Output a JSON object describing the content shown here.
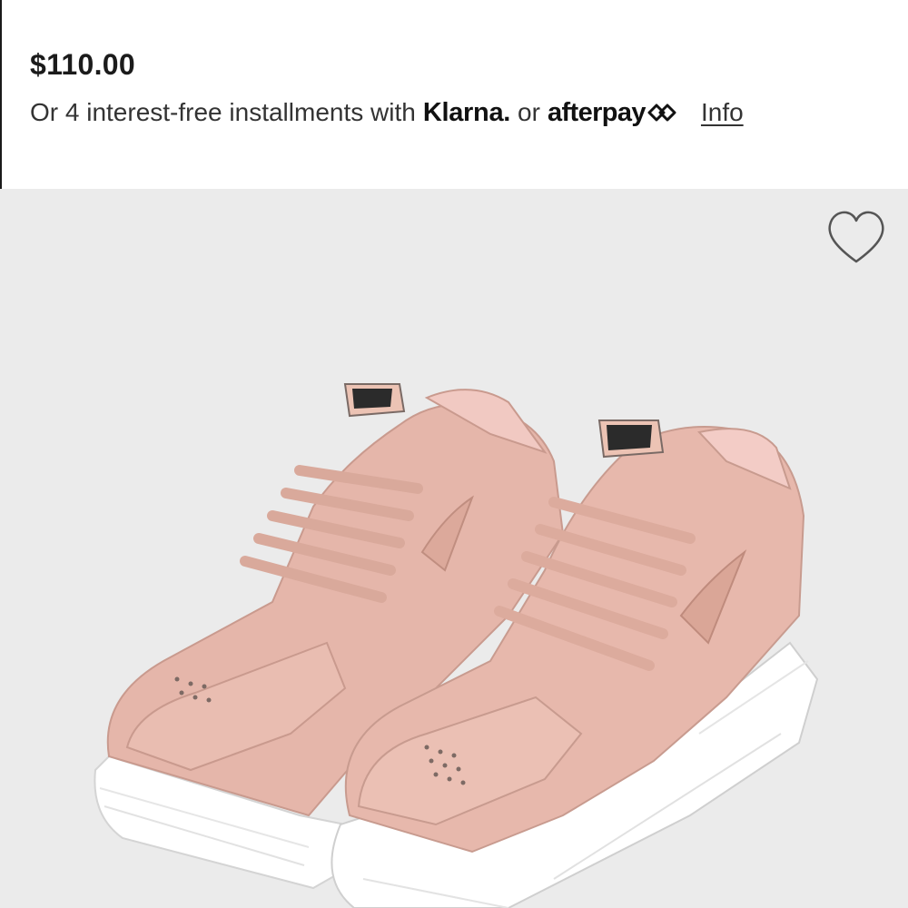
{
  "product": {
    "price": "$110.00",
    "installments_text": "Or 4 interest-free installments with",
    "klarna_label": "Klarna.",
    "or_text": "or",
    "afterpay_label": "afterpay",
    "info_label": "Info"
  },
  "image": {
    "description_icon": "sneakers-image",
    "favorite_icon": "heart-outline-icon"
  },
  "colors": {
    "background": "#ffffff",
    "image_background": "#ebebeb",
    "shoe_leather": "#e7b8ac",
    "sole": "#ffffff",
    "text": "#333333"
  }
}
